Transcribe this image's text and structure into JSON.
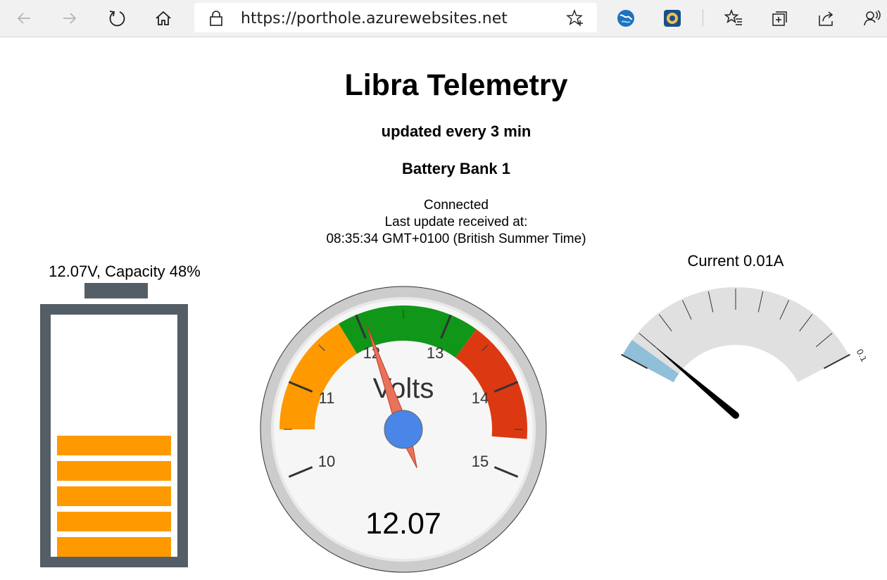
{
  "browser": {
    "url": "https://porthole.azurewebsites.net",
    "icons": [
      "back-arrow-icon",
      "forward-arrow-icon",
      "refresh-icon",
      "home-icon",
      "lock-icon",
      "add-favorite-star-icon",
      "extension-globe-icon",
      "extension-badge-icon",
      "favorites-icon",
      "collections-icon",
      "share-icon",
      "read-aloud-icon"
    ]
  },
  "page": {
    "title": "Libra Telemetry",
    "subtitle": "updated every 3 min",
    "bank": "Battery Bank 1",
    "status": {
      "connection": "Connected",
      "last_update_label": "Last update received at:",
      "last_update_time": "08:35:34 GMT+0100 (British Summer Time)"
    }
  },
  "battery": {
    "label": "12.07V, Capacity 48%",
    "capacity_percent": 48,
    "filled_segments": 5,
    "total_segments": 10,
    "colors": {
      "frame": "#545e67",
      "fill": "#ff9900"
    }
  },
  "voltage_gauge": {
    "label": "Volts",
    "value": 12.07,
    "value_text": "12.07",
    "min": 9.5,
    "max": 15.5,
    "major_ticks": [
      "10",
      "11",
      "12",
      "13",
      "14",
      "15"
    ],
    "bands": [
      {
        "from": 10.5,
        "to": 11.8,
        "color": "#ff9900"
      },
      {
        "from": 11.8,
        "to": 13.3,
        "color": "#109618"
      },
      {
        "from": 13.3,
        "to": 14.6,
        "color": "#dc3912"
      }
    ],
    "needle_color": "#e8735a",
    "hub_color": "#4a86e8"
  },
  "current_gauge": {
    "label": "Current 0.01A",
    "value": 0.01,
    "min": 0,
    "max": 0.1,
    "max_tick_label": "0.1",
    "band_color": "#8fbfd9",
    "track_color": "#e0e0e0"
  }
}
